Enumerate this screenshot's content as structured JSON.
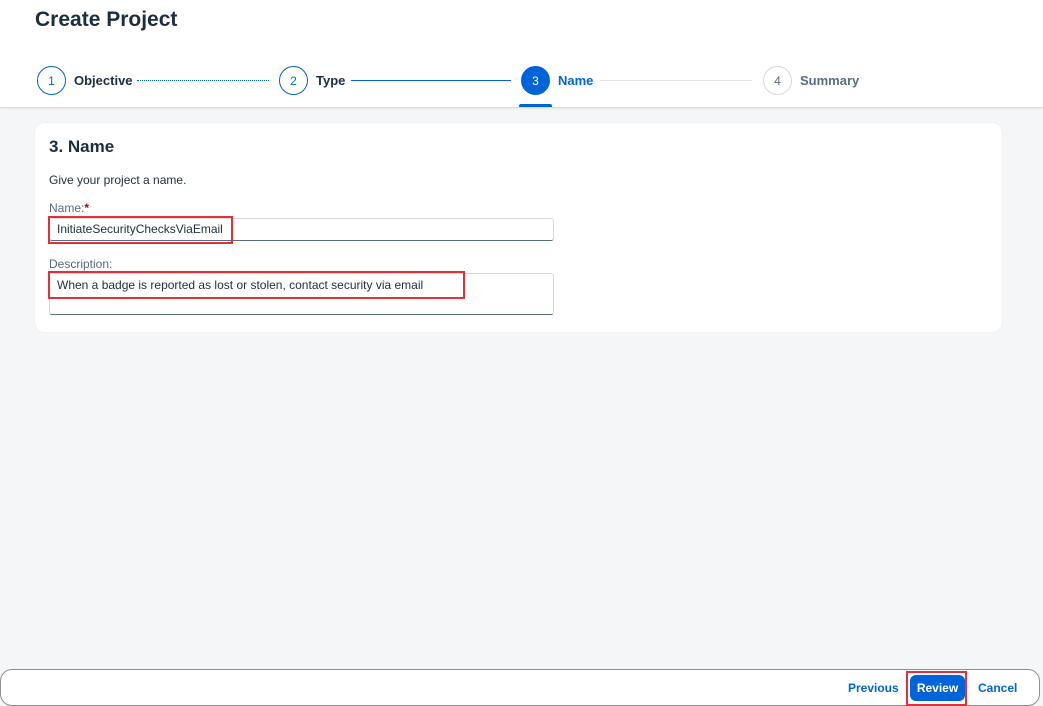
{
  "page": {
    "title": "Create Project"
  },
  "wizard": {
    "steps": [
      {
        "number": "1",
        "label": "Objective",
        "state": "completed"
      },
      {
        "number": "2",
        "label": "Type",
        "state": "completed"
      },
      {
        "number": "3",
        "label": "Name",
        "state": "active"
      },
      {
        "number": "4",
        "label": "Summary",
        "state": "future"
      }
    ]
  },
  "form": {
    "section_title": "3. Name",
    "description": "Give your project a name.",
    "name_label": "Name:",
    "required_marker": "*",
    "name_value": "InitiateSecurityChecksViaEmail",
    "description_label": "Description:",
    "description_value": "When a badge is reported as lost or stolen, contact security via email"
  },
  "footer": {
    "previous_label": "Previous",
    "review_label": "Review",
    "cancel_label": "Cancel"
  },
  "colors": {
    "accent": "#0064d9",
    "highlight": "#e0303a",
    "required": "#aa0808"
  }
}
